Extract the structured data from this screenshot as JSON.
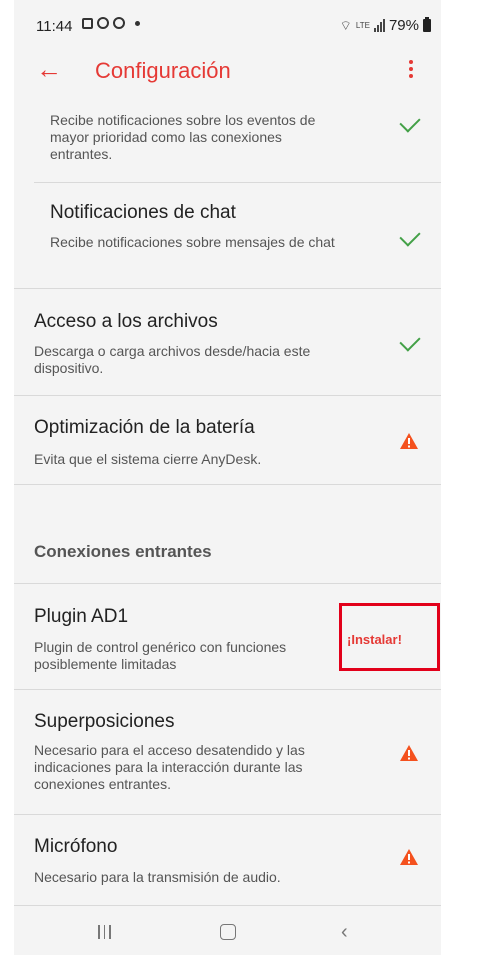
{
  "status_bar": {
    "time": "11:44",
    "battery": "79%",
    "network": "LTE"
  },
  "app_bar": {
    "back_icon": "arrow-left-icon",
    "title": "Configuración",
    "menu_icon": "overflow-menu-icon"
  },
  "settings": {
    "notifications_priority": {
      "description": "Recibe notificaciones sobre los eventos de mayor prioridad como las conexiones entrantes.",
      "status": "check-icon"
    },
    "chat_notifications": {
      "title": "Notificaciones de chat",
      "description": "Recibe notificaciones sobre mensajes de chat",
      "status": "check-icon"
    },
    "file_access": {
      "title": "Acceso a los archivos",
      "description": "Descarga o carga archivos desde/hacia este dispositivo.",
      "status": "check-icon"
    },
    "battery_optimization": {
      "title": "Optimización de la batería",
      "description": "Evita que el sistema cierre AnyDesk.",
      "status": "warning-icon"
    }
  },
  "incoming_section": {
    "heading": "Conexiones entrantes",
    "plugin": {
      "title": "Plugin AD1",
      "description": "Plugin de control genérico con funciones posiblemente limitadas",
      "action_label": "¡Instalar!"
    },
    "overlays": {
      "title": "Superposiciones",
      "description": "Necesario para el acceso desatendido y las indicaciones para la interacción durante las conexiones entrantes.",
      "status": "warning-icon"
    },
    "microphone": {
      "title": "Micrófono",
      "description": "Necesario para la transmisión de audio.",
      "status": "warning-icon"
    }
  },
  "colors": {
    "accent": "#e53935",
    "check": "#43a047",
    "warning": "#f4511e",
    "highlight_box": "#e2001a"
  }
}
